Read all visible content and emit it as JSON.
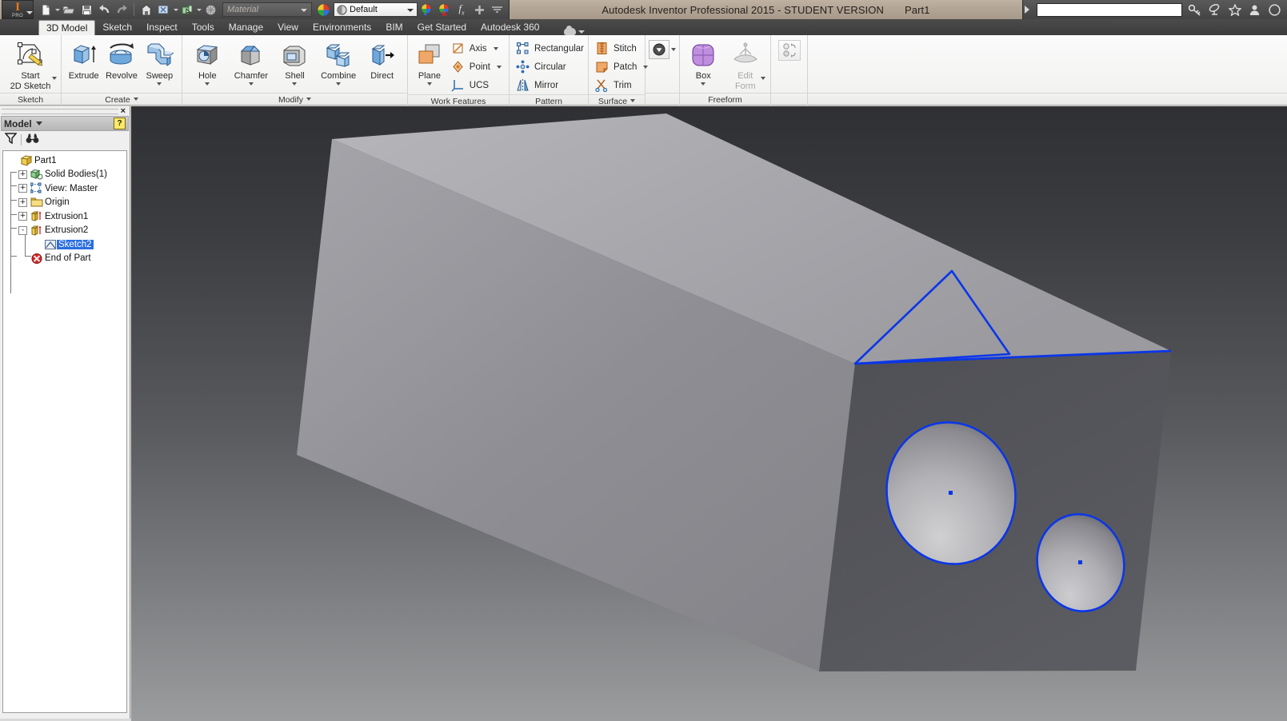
{
  "app": {
    "title": "Autodesk Inventor Professional 2015 - STUDENT VERSION",
    "document_name": "Part1",
    "logo_letter": "I",
    "logo_sub": "PRO",
    "accent_color": "#e8791d",
    "sketch_color": "#0b36e8"
  },
  "quick_access": {
    "items": [
      {
        "name": "new-file-icon",
        "label": "New",
        "has_dropdown": true
      },
      {
        "name": "open-file-icon",
        "label": "Open",
        "has_dropdown": false
      },
      {
        "name": "save-icon",
        "label": "Save",
        "has_dropdown": false
      },
      {
        "name": "undo-icon",
        "label": "Undo",
        "has_dropdown": false
      },
      {
        "name": "redo-icon",
        "label": "Redo",
        "has_dropdown": false
      },
      {
        "name": "home-icon",
        "label": "Home View",
        "has_dropdown": false
      },
      {
        "name": "return-icon",
        "label": "Return",
        "has_dropdown": true
      },
      {
        "name": "update-icon",
        "label": "Update",
        "has_dropdown": true
      },
      {
        "name": "material-browser-icon",
        "label": "Material Browser",
        "has_dropdown": false
      }
    ],
    "material": {
      "value": "",
      "placeholder": "Material"
    },
    "appearance": {
      "value": "Default"
    },
    "after_appearance": [
      {
        "name": "appearance-override-icon",
        "label": "Adjust Appearance"
      },
      {
        "name": "clear-appearance-icon",
        "label": "Clear Appearance Override"
      },
      {
        "name": "parameters-icon",
        "label": "Parameters"
      },
      {
        "name": "add-to-qat-icon",
        "label": "Add Command"
      },
      {
        "name": "customize-qat-icon",
        "label": "Customize Quick Access Toolbar"
      }
    ]
  },
  "title_right": {
    "search": {
      "value": "",
      "placeholder": ""
    },
    "icons": [
      {
        "name": "sign-in-key-icon",
        "label": "Sign In"
      },
      {
        "name": "exchange-apps-icon",
        "label": "Autodesk Exchange Apps"
      },
      {
        "name": "favorites-star-icon",
        "label": "Favorites"
      },
      {
        "name": "user-account-icon",
        "label": "Account"
      },
      {
        "name": "help-icon",
        "label": "Help"
      }
    ]
  },
  "tabs": {
    "items": [
      {
        "label": "3D Model",
        "active": true
      },
      {
        "label": "Sketch",
        "active": false
      },
      {
        "label": "Inspect",
        "active": false
      },
      {
        "label": "Tools",
        "active": false
      },
      {
        "label": "Manage",
        "active": false
      },
      {
        "label": "View",
        "active": false
      },
      {
        "label": "Environments",
        "active": false
      },
      {
        "label": "BIM",
        "active": false
      },
      {
        "label": "Get Started",
        "active": false
      },
      {
        "label": "Autodesk 360",
        "active": false
      }
    ],
    "cloud_menu": {
      "name": "cloud-status-icon",
      "label": ""
    }
  },
  "ribbon": {
    "panels": [
      {
        "label": "Sketch",
        "has_dropdown": false,
        "big_buttons": [
          {
            "label": "Start\n2D Sketch",
            "label_line1": "Start",
            "label_line2": "2D Sketch",
            "icon": "start-2d-sketch-icon",
            "dropdown": "side",
            "disabled": false
          }
        ],
        "small_groups": []
      },
      {
        "label": "Create",
        "has_dropdown": true,
        "big_buttons": [
          {
            "label_line1": "Extrude",
            "label_line2": "",
            "icon": "extrude-icon",
            "dropdown": "none",
            "disabled": false
          },
          {
            "label_line1": "Revolve",
            "label_line2": "",
            "icon": "revolve-icon",
            "dropdown": "none",
            "disabled": false
          },
          {
            "label_line1": "Sweep",
            "label_line2": "",
            "icon": "sweep-icon",
            "dropdown": "below",
            "disabled": false
          }
        ],
        "small_groups": []
      },
      {
        "label": "Modify",
        "has_dropdown": true,
        "big_buttons": [
          {
            "label_line1": "Hole",
            "label_line2": "",
            "icon": "hole-icon",
            "dropdown": "below",
            "disabled": false
          },
          {
            "label_line1": "Chamfer",
            "label_line2": "",
            "icon": "chamfer-icon",
            "dropdown": "below",
            "disabled": false
          },
          {
            "label_line1": "Shell",
            "label_line2": "",
            "icon": "shell-icon",
            "dropdown": "below",
            "disabled": false
          },
          {
            "label_line1": "Combine",
            "label_line2": "",
            "icon": "combine-icon",
            "dropdown": "below",
            "disabled": false
          },
          {
            "label_line1": "Direct",
            "label_line2": "",
            "icon": "direct-edit-icon",
            "dropdown": "none",
            "disabled": false
          }
        ],
        "small_groups": []
      },
      {
        "label": "Work Features",
        "has_dropdown": false,
        "big_buttons": [
          {
            "label_line1": "Plane",
            "label_line2": "",
            "icon": "work-plane-icon",
            "dropdown": "below",
            "disabled": false
          }
        ],
        "small_groups": [
          [
            {
              "label": "Axis",
              "icon": "work-axis-icon",
              "dropdown": true
            },
            {
              "label": "Point",
              "icon": "work-point-icon",
              "dropdown": true
            },
            {
              "label": "UCS",
              "icon": "ucs-icon",
              "dropdown": false
            }
          ]
        ]
      },
      {
        "label": "Pattern",
        "has_dropdown": false,
        "big_buttons": [],
        "small_groups": [
          [
            {
              "label": "Rectangular",
              "icon": "rectangular-pattern-icon",
              "dropdown": false
            },
            {
              "label": "Circular",
              "icon": "circular-pattern-icon",
              "dropdown": false
            },
            {
              "label": "Mirror",
              "icon": "mirror-icon",
              "dropdown": false
            }
          ]
        ]
      },
      {
        "label": "Surface",
        "has_dropdown": true,
        "big_buttons": [],
        "small_groups": [
          [
            {
              "label": "Stitch",
              "icon": "stitch-icon",
              "dropdown": false
            },
            {
              "label": "Patch",
              "icon": "patch-icon",
              "dropdown": true
            },
            {
              "label": "Trim",
              "icon": "trim-icon",
              "dropdown": false
            }
          ]
        ]
      },
      {
        "label": "",
        "has_dropdown": false,
        "big_buttons": [],
        "small_groups": [],
        "plastic_part_button": {
          "name": "plastic-part-icon",
          "dropdown": true
        }
      },
      {
        "label": "Freeform",
        "has_dropdown": false,
        "big_buttons": [
          {
            "label_line1": "Box",
            "label_line2": "",
            "icon": "freeform-box-icon",
            "dropdown": "below",
            "disabled": false
          },
          {
            "label_line1": "Edit",
            "label_line2": "Form",
            "icon": "edit-form-icon",
            "dropdown": "side",
            "disabled": true
          }
        ],
        "small_groups": []
      },
      {
        "label": "",
        "has_dropdown": false,
        "big_buttons": [],
        "small_groups": [],
        "convert_button": {
          "name": "convert-to-freeform-icon",
          "dropdown": false
        }
      }
    ]
  },
  "browser": {
    "title": "Model",
    "close_label": "×",
    "help_label": "?",
    "tools": [
      {
        "name": "filter-icon",
        "label": "Filter"
      },
      {
        "name": "find-binoculars-icon",
        "label": "Find"
      }
    ],
    "tree": [
      {
        "label": "Part1",
        "depth": 0,
        "expander": "",
        "icon": "part-icon",
        "selected": false
      },
      {
        "label": "Solid Bodies(1)",
        "depth": 1,
        "expander": "+",
        "icon": "solid-bodies-icon",
        "selected": false
      },
      {
        "label": "View: Master",
        "depth": 1,
        "expander": "+",
        "icon": "view-master-icon",
        "selected": false
      },
      {
        "label": "Origin",
        "depth": 1,
        "expander": "+",
        "icon": "folder-icon",
        "selected": false
      },
      {
        "label": "Extrusion1",
        "depth": 1,
        "expander": "+",
        "icon": "extrusion-icon",
        "selected": false
      },
      {
        "label": "Extrusion2",
        "depth": 1,
        "expander": "-",
        "icon": "extrusion-icon",
        "selected": false
      },
      {
        "label": "Sketch2",
        "depth": 2,
        "expander": "",
        "icon": "sketch-icon",
        "selected": true
      },
      {
        "label": "End of Part",
        "depth": 1,
        "expander": "",
        "icon": "end-of-part-icon",
        "selected": false
      }
    ]
  },
  "viewport": {
    "model_name": "Part1",
    "sketch_entities": {
      "triangle": {
        "color": "#0b36e8",
        "visible": true
      },
      "circles": [
        {
          "name": "large-circle",
          "color": "#0b36e8",
          "center_marker": true
        },
        {
          "name": "small-circle",
          "color": "#0b36e8",
          "center_marker": true
        }
      ],
      "base_line": {
        "color": "#0b36e8",
        "visible": true
      }
    }
  }
}
